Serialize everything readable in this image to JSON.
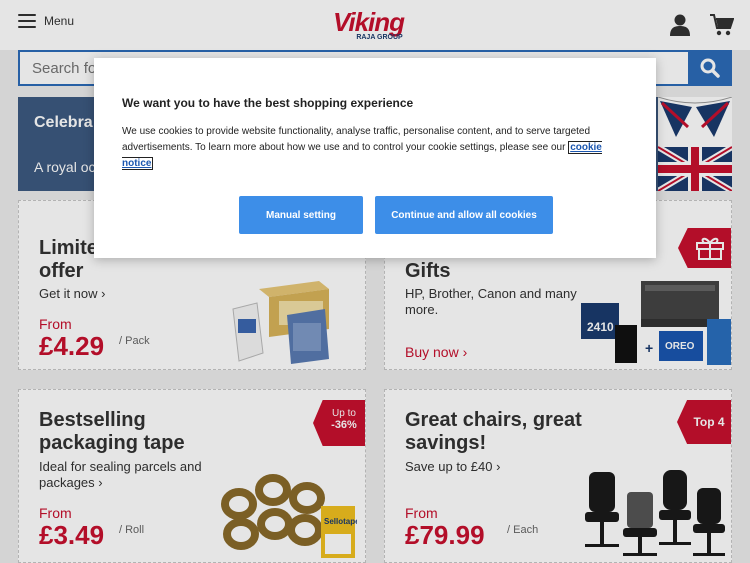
{
  "header": {
    "menu_label": "Menu",
    "logo_text": "Viking",
    "logo_sub": "RAJA GROUP"
  },
  "search": {
    "placeholder": "Search for products..."
  },
  "banner": {
    "title": "Celebra",
    "subtitle": "A royal oc"
  },
  "cards": {
    "paper": {
      "title_line1": "Limite",
      "title_line2": "offer",
      "link": "Get it now ›",
      "from": "From",
      "price": "£4.29",
      "unit": "/ Pack"
    },
    "gifts": {
      "title": "Gifts",
      "text": "HP, Brother, Canon and many more.",
      "buy": "Buy now ›"
    },
    "tape": {
      "title_line1": "Bestselling",
      "title_line2": "packaging tape",
      "text": "Ideal for sealing parcels and packages ›",
      "from": "From",
      "price": "£3.49",
      "unit": "/ Roll",
      "tag_line1": "Up to",
      "tag_line2": "-36%"
    },
    "chairs": {
      "title_line1": "Great chairs, great",
      "title_line2": "savings!",
      "link": "Save up to £40 ›",
      "from": "From",
      "price": "£79.99",
      "unit": "/ Each",
      "tag": "Top 4"
    }
  },
  "cookie": {
    "title": "We want you to have the best shopping experience",
    "text": "We use cookies to provide website functionality, analyse traffic, personalise content, and to serve targeted advertisements. To learn more about how we use and to control your cookie settings, please see our",
    "link": "cookie notice",
    "manual_button": "Manual setting",
    "continue_button": "Continue and allow all cookies"
  },
  "colors": {
    "brand_red": "#c8102e",
    "brand_blue": "#2c6bb8",
    "button_blue": "#3d8ee8"
  },
  "icons": [
    "menu-icon",
    "account-icon",
    "cart-icon",
    "search-icon",
    "gift-icon"
  ]
}
